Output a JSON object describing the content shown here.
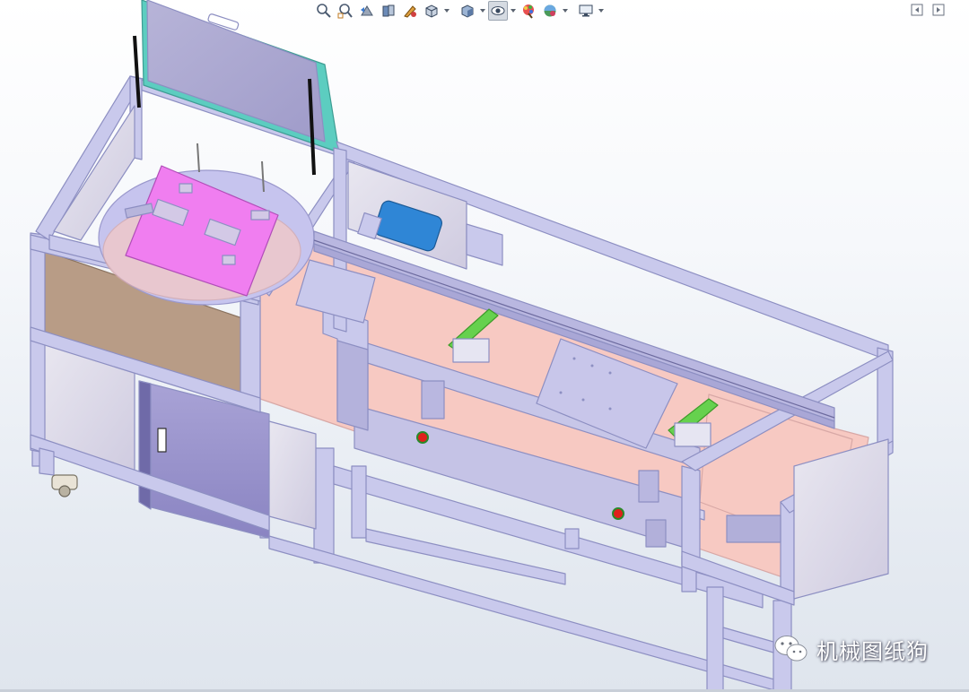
{
  "toolbar": {
    "items": [
      {
        "icon": "zoom-to-fit-icon"
      },
      {
        "icon": "zoom-to-area-icon"
      },
      {
        "icon": "previous-view-icon"
      },
      {
        "icon": "section-view-icon"
      },
      {
        "icon": "dynamic-annotation-icon"
      },
      {
        "icon": "view-orientation-icon",
        "dropdown": true
      },
      {
        "icon": "display-style-icon",
        "dropdown": true
      },
      {
        "icon": "hide-show-items-icon",
        "dropdown": true,
        "active": true
      },
      {
        "icon": "edit-appearance-icon"
      },
      {
        "icon": "apply-scene-icon",
        "dropdown": true
      },
      {
        "icon": "view-settings-icon",
        "dropdown": true
      }
    ]
  },
  "window_controls": [
    {
      "icon": "panel-collapse-left-icon"
    },
    {
      "icon": "panel-expand-right-icon"
    }
  ],
  "watermark": {
    "text": "机械图纸狗",
    "icon": "wechat-logo-icon"
  },
  "colors": {
    "frame_fill": "#c9c9ec",
    "frame_stroke": "#8d8fc2",
    "table_pink": "#f7c9c2",
    "fixture_magenta": "#f07ef0",
    "glass_teal": "#5ccdc0",
    "wood_panel": "#b89c86",
    "motor_blue": "#2f86d6",
    "rail_green": "#66d14e",
    "button_red": "#e0201c"
  }
}
